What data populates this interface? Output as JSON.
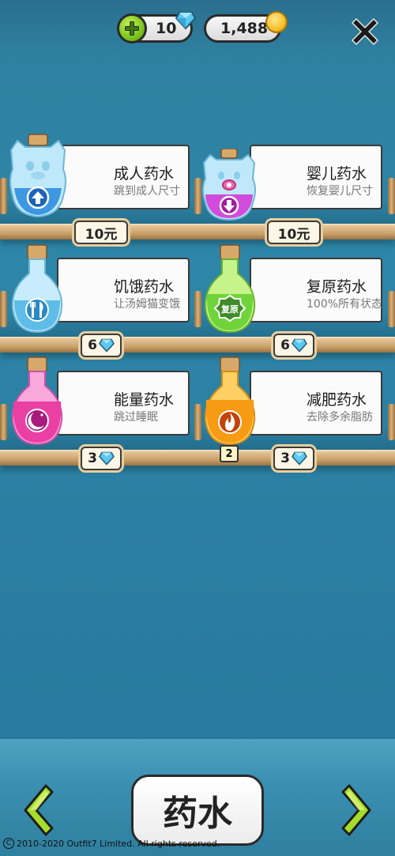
{
  "header": {
    "gems": "10",
    "coins": "1,488"
  },
  "potions": [
    {
      "name": "成人药水",
      "desc": "跳到成人尺寸",
      "price": "10元",
      "price_type": "cash"
    },
    {
      "name": "婴儿药水",
      "desc": "恢复婴儿尺寸",
      "price": "10元",
      "price_type": "cash"
    },
    {
      "name": "饥饿药水",
      "desc": "让汤姆猫变饿",
      "price": "6",
      "price_type": "gem"
    },
    {
      "name": "复原药水",
      "desc": "100%所有状态",
      "price": "6",
      "price_type": "gem",
      "bottle_label": "复原"
    },
    {
      "name": "能量药水",
      "desc": "跳过睡眠",
      "price": "3",
      "price_type": "gem"
    },
    {
      "name": "减肥药水",
      "desc": "去除多余脂肪",
      "price": "3",
      "price_type": "gem",
      "owned_count": "2"
    }
  ],
  "footer": {
    "title": "药水",
    "copyright": "2010-2020 Outfit7 Limited. All rights reserved.",
    "copyright_symbol": "C"
  },
  "colors": {
    "background": "#2d86a8",
    "shelf": "#c9a06a",
    "gem": "#5bc8f0",
    "plus": "#7cc51d",
    "coin": "#f5c02b"
  }
}
